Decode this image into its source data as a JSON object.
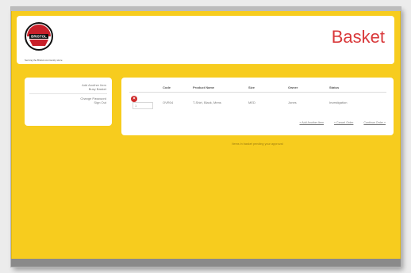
{
  "header": {
    "title": "Basket",
    "logo_text": "BRISTOL",
    "logo_tagline": "Serving the Bristol community since"
  },
  "sidebar": {
    "links": [
      {
        "label": "Add Another Item"
      },
      {
        "label": "Busy Basket"
      },
      {
        "label": "Change Password"
      },
      {
        "label": "Sign Out"
      }
    ]
  },
  "basket": {
    "columns": [
      "",
      "Code",
      "Product Name",
      "Size",
      "Owner",
      "Status"
    ],
    "rows": [
      {
        "qty": "1",
        "code": "OVR04",
        "name": "T-Shirt, Black, Mens",
        "size": "MED",
        "owner": "Jones",
        "status": "Investigation"
      }
    ],
    "actions": [
      "« Add Another Item",
      "« Cancel Order",
      "Continue Order »"
    ]
  },
  "message": "Items in basket pending your approval"
}
